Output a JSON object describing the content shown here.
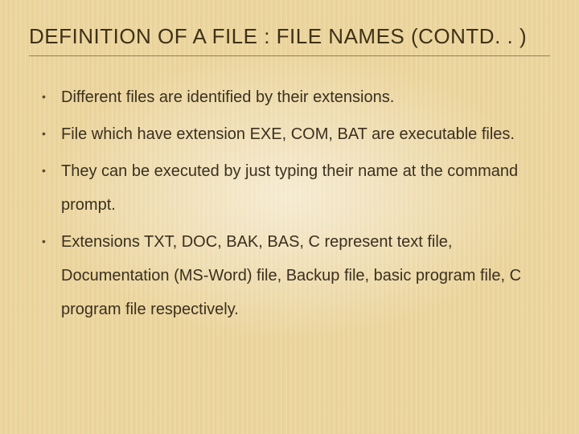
{
  "title": "DEFINITION OF A FILE : FILE NAMES (CONTD. . )",
  "bullets": [
    "Different files are identified by their extensions.",
    "File which have extension EXE, COM, BAT are executable files.",
    "They can be executed by just typing their name at the command prompt.",
    "Extensions TXT, DOC, BAK, BAS, C represent text file, Documentation (MS-Word) file, Backup file, basic program file, C program file respectively."
  ]
}
